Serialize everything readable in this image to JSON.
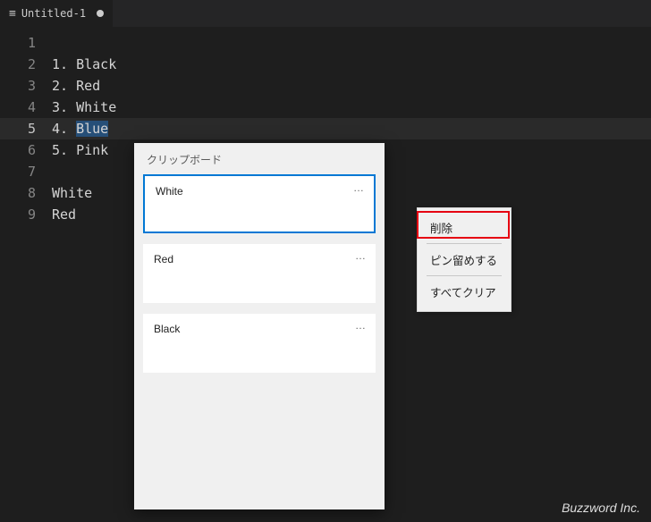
{
  "tab": {
    "title": "Untitled-1"
  },
  "editor": {
    "lines": [
      "",
      "1. Black",
      "2. Red",
      "3. White",
      "4. Blue",
      "5. Pink",
      "",
      "White",
      "Red"
    ],
    "current_line_index": 4,
    "selection": {
      "line_index": 4,
      "text": "Blue"
    }
  },
  "clipboard": {
    "title": "クリップボード",
    "items": [
      {
        "text": "White",
        "more": "…",
        "selected": true
      },
      {
        "text": "Red",
        "more": "…",
        "selected": false
      },
      {
        "text": "Black",
        "more": "…",
        "selected": false
      }
    ]
  },
  "context_menu": {
    "items": [
      {
        "label": "削除",
        "highlighted": true
      },
      {
        "label": "ピン留めする",
        "highlighted": false
      },
      {
        "label": "すべてクリア",
        "highlighted": false
      }
    ]
  },
  "watermark": "Buzzword Inc."
}
